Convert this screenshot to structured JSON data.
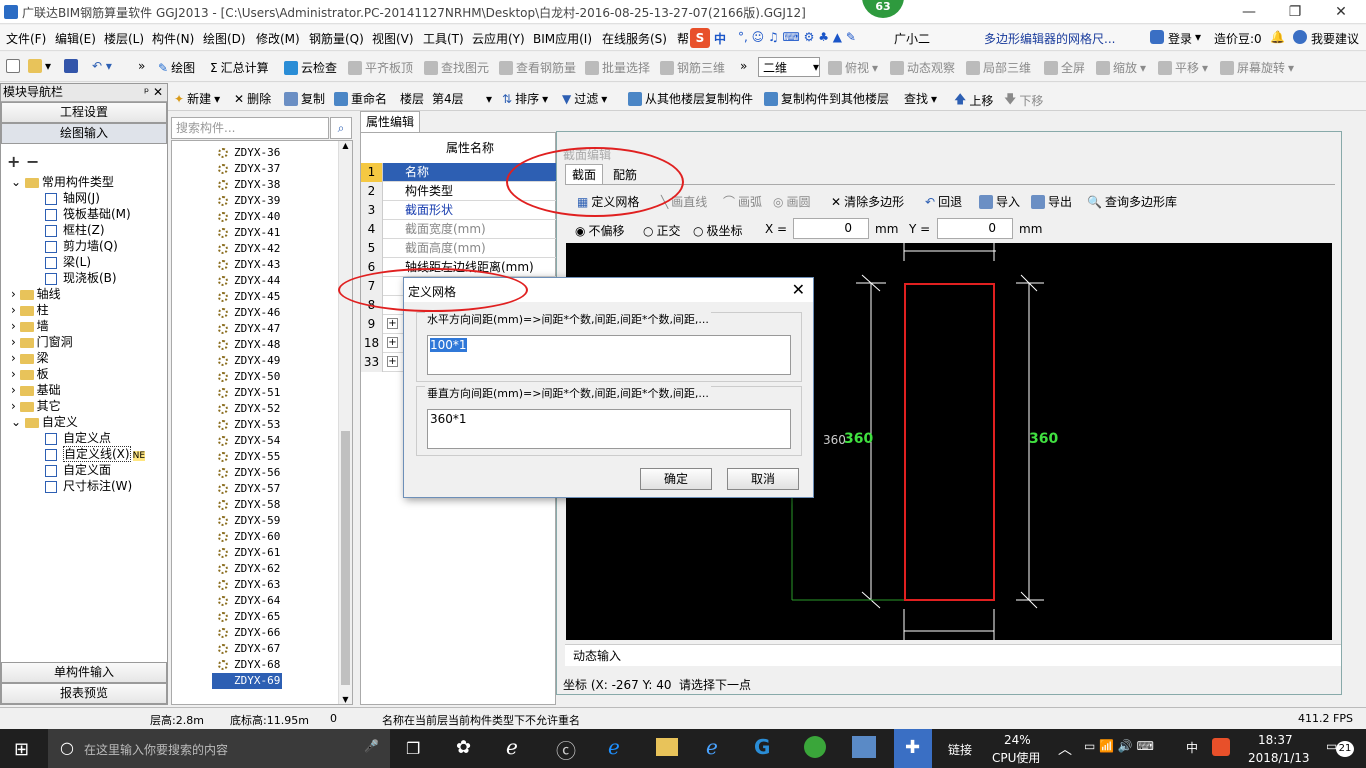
{
  "window": {
    "title": "广联达BIM钢筋算量软件 GGJ2013 - [C:\\Users\\Administrator.PC-20141127NRHM\\Desktop\\白龙村-2016-08-25-13-27-07(2166版).GGJ12]",
    "badge": "63"
  },
  "menu": [
    "文件(F)",
    "编辑(E)",
    "楼层(L)",
    "构件(N)",
    "绘图(D)",
    "修改(M)",
    "钢筋量(Q)",
    "视图(V)",
    "工具(T)",
    "云应用(Y)",
    "BIM应用(I)",
    "在线服务(S)",
    "帮"
  ],
  "menu_right": {
    "ime": "中",
    "guangxiaoer": "广小二",
    "tip": "多边形编辑器的网格尺...",
    "login": "登录",
    "price": "造价豆:0",
    "suggest": "我要建议"
  },
  "toolbar1": {
    "draw": "绘图",
    "sum": "汇总计算",
    "cloud_check": "云检查",
    "level_slab": "平齐板顶",
    "find_elem": "查找图元",
    "view_rebar": "查看钢筋量",
    "batch_select": "批量选择",
    "rebar3d": "钢筋三维",
    "view2d": "二维",
    "plan_view": "俯视",
    "dyn_view": "动态观察",
    "local3d": "局部三维",
    "fullscreen": "全屏",
    "zoom": "缩放",
    "pan": "平移",
    "rotate": "屏幕旋转"
  },
  "toolbar2": {
    "new": "新建",
    "delete": "删除",
    "copy": "复制",
    "rename": "重命名",
    "floor_label": "楼层",
    "floor_value": "第4层",
    "sort": "排序",
    "filter": "过滤",
    "copy_from": "从其他楼层复制构件",
    "copy_to": "复制构件到其他楼层",
    "find": "查找",
    "move_up": "上移",
    "move_down": "下移"
  },
  "nav": {
    "title": "模块导航栏",
    "project_settings": "工程设置",
    "draw_input": "绘图输入",
    "single_input": "单构件输入",
    "report": "报表预览",
    "tree": [
      {
        "label": "常用构件类型",
        "level": 0,
        "type": "folder"
      },
      {
        "label": "轴网(J)",
        "level": 1,
        "type": "item"
      },
      {
        "label": "筏板基础(M)",
        "level": 1,
        "type": "item"
      },
      {
        "label": "框柱(Z)",
        "level": 1,
        "type": "item"
      },
      {
        "label": "剪力墙(Q)",
        "level": 1,
        "type": "item"
      },
      {
        "label": "梁(L)",
        "level": 1,
        "type": "item"
      },
      {
        "label": "现浇板(B)",
        "level": 1,
        "type": "item"
      },
      {
        "label": "轴线",
        "level": 0,
        "type": "folder"
      },
      {
        "label": "柱",
        "level": 0,
        "type": "folder"
      },
      {
        "label": "墙",
        "level": 0,
        "type": "folder"
      },
      {
        "label": "门窗洞",
        "level": 0,
        "type": "folder"
      },
      {
        "label": "梁",
        "level": 0,
        "type": "folder"
      },
      {
        "label": "板",
        "level": 0,
        "type": "folder"
      },
      {
        "label": "基础",
        "level": 0,
        "type": "folder"
      },
      {
        "label": "其它",
        "level": 0,
        "type": "folder"
      },
      {
        "label": "自定义",
        "level": 0,
        "type": "folder"
      },
      {
        "label": "自定义点",
        "level": 1,
        "type": "item"
      },
      {
        "label": "自定义线(X)",
        "level": 1,
        "type": "item"
      },
      {
        "label": "自定义面",
        "level": 1,
        "type": "item"
      },
      {
        "label": "尺寸标注(W)",
        "level": 1,
        "type": "item"
      }
    ],
    "new_tag": "NE"
  },
  "search": {
    "placeholder": "搜索构件..."
  },
  "components": [
    "ZDYX-36",
    "ZDYX-37",
    "ZDYX-38",
    "ZDYX-39",
    "ZDYX-40",
    "ZDYX-41",
    "ZDYX-42",
    "ZDYX-43",
    "ZDYX-44",
    "ZDYX-45",
    "ZDYX-46",
    "ZDYX-47",
    "ZDYX-48",
    "ZDYX-49",
    "ZDYX-50",
    "ZDYX-51",
    "ZDYX-52",
    "ZDYX-53",
    "ZDYX-54",
    "ZDYX-55",
    "ZDYX-56",
    "ZDYX-57",
    "ZDYX-58",
    "ZDYX-59",
    "ZDYX-60",
    "ZDYX-61",
    "ZDYX-62",
    "ZDYX-63",
    "ZDYX-64",
    "ZDYX-65",
    "ZDYX-66",
    "ZDYX-67",
    "ZDYX-68",
    "ZDYX-69"
  ],
  "props": {
    "tab": "属性编辑",
    "header": "属性名称",
    "rows": [
      {
        "num": "1",
        "label": "名称"
      },
      {
        "num": "2",
        "label": "构件类型"
      },
      {
        "num": "3",
        "label": "截面形状"
      },
      {
        "num": "4",
        "label": "截面宽度(mm)"
      },
      {
        "num": "5",
        "label": "截面高度(mm)"
      },
      {
        "num": "6",
        "label": "轴线距左边线距离(mm)"
      },
      {
        "num": "7",
        "label": ""
      },
      {
        "num": "8",
        "label": ""
      },
      {
        "num": "9",
        "label": ""
      },
      {
        "num": "18",
        "label": ""
      },
      {
        "num": "33",
        "label": ""
      }
    ]
  },
  "editor": {
    "title": "截面编辑",
    "tab_section": "截面",
    "tab_rebar": "配筋",
    "define_grid": "定义网格",
    "line": "画直线",
    "arc": "画弧",
    "circle": "画圆",
    "clear": "清除多边形",
    "undo": "回退",
    "import": "导入",
    "export": "导出",
    "query": "查询多边形库",
    "no_offset": "不偏移",
    "ortho": "正交",
    "polar": "极坐标",
    "x_label": "X =",
    "x_value": "0",
    "y_label": "Y =",
    "y_value": "0",
    "unit": "mm",
    "dim_left": "360",
    "dim_left2": "360",
    "dim_right": "360",
    "dynamic_input": "动态输入",
    "coord": "坐标 (X: -267 Y: 40",
    "prompt": "请选择下一点"
  },
  "dialog": {
    "title": "定义网格",
    "h_label": "水平方向间距(mm)=>间距*个数,间距,间距*个数,间距,...",
    "h_value": "100*1",
    "v_label": "垂直方向间距(mm)=>间距*个数,间距,间距*个数,间距,...",
    "v_value": "360*1",
    "ok": "确定",
    "cancel": "取消"
  },
  "status": {
    "floor_height": "层高:2.8m",
    "base_height": "底标高:11.95m",
    "zero": "0",
    "message": "名称在当前层当前构件类型下不允许重名",
    "fps": "411.2 FPS"
  },
  "taskbar": {
    "search": "在这里输入你要搜索的内容",
    "link": "链接",
    "cpu": "24%",
    "cpu_label": "CPU使用",
    "ime": "中",
    "time": "18:37",
    "date": "2018/1/13",
    "notif": "21"
  },
  "colors": {
    "accent_red": "#e02020",
    "dim_green": "#40e040",
    "canvas_bg": "#000000"
  }
}
